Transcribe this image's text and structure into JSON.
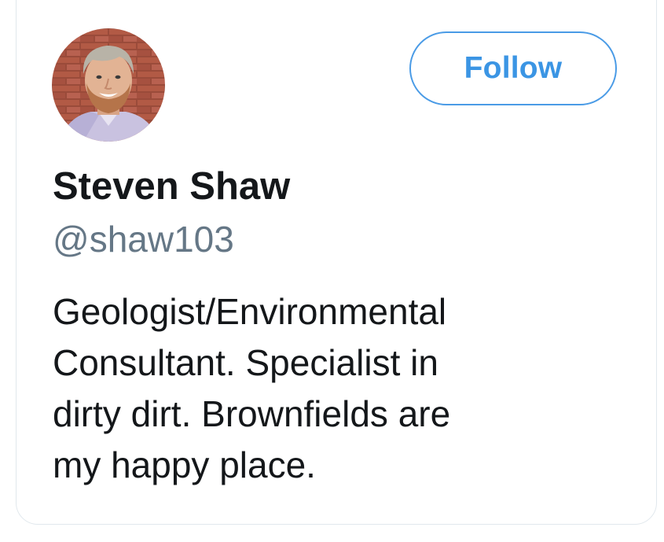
{
  "profile": {
    "display_name": "Steven Shaw",
    "handle": "@shaw103",
    "avatar_icon": "profile-photo",
    "bio_lines": [
      "Geologist/Environmental",
      "Consultant. Specialist in",
      "dirty dirt. Brownfields are",
      "my happy place."
    ]
  },
  "actions": {
    "follow_label": "Follow"
  },
  "colors": {
    "accent": "#3b95e4",
    "name_text": "#14171a",
    "handle_text": "#657786",
    "border": "#e1e8ed"
  }
}
